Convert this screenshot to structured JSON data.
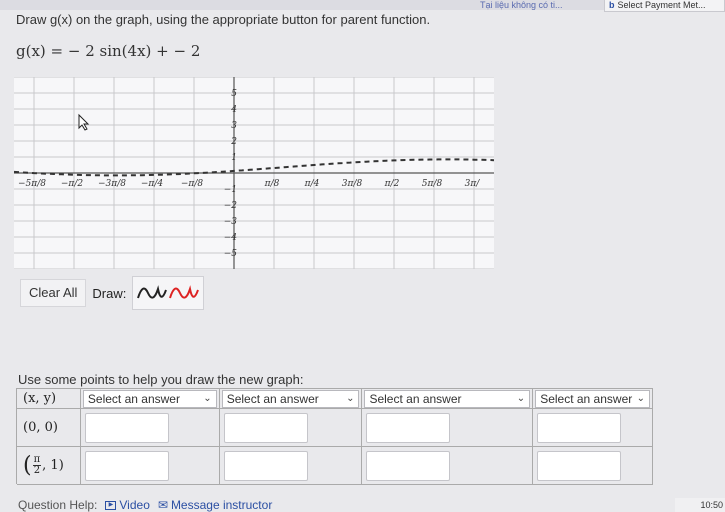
{
  "header": {
    "top_partial_text": "Tại liệu không có ti...",
    "payment_badge": "b",
    "payment_label": "Select Payment Met..."
  },
  "problem": {
    "instruction": "Draw g(x) on the graph, using the appropriate button for parent function.",
    "formula": "g(x)  =   − 2 sin(4x) +  − 2"
  },
  "graph": {
    "x_tick_labels": [
      "−5π/8",
      "−π/2",
      "−3π/8",
      "−π/4",
      "−π/8",
      "π/8",
      "π/4",
      "3π/8",
      "π/2",
      "5π/8",
      "3π/"
    ],
    "y_tick_labels": [
      "5",
      "4",
      "3",
      "2",
      "1",
      "−1",
      "−2",
      "−3",
      "−4",
      "−5"
    ],
    "x_min": -5.5,
    "x_max": 6.5,
    "y_min": -6,
    "y_max": 6
  },
  "controls": {
    "clear_all": "Clear All",
    "draw_label": "Draw:",
    "draw_button_icon": "sine-wave-icon"
  },
  "table": {
    "caption": "Use some points to help you draw the new graph:",
    "header_xy": "(x, y)",
    "dropdowns": [
      "Select an answer",
      "Select an answer",
      "Select an answer",
      "Select an answer"
    ],
    "rows": [
      {
        "point": "(0, 0)"
      },
      {
        "point_prefix": "(",
        "frac_num": "π",
        "frac_den": "2",
        "point_suffix": ", 1)"
      }
    ]
  },
  "footer": {
    "question_help": "Question Help:",
    "video": "Video",
    "message": "Message instructor",
    "clock": "10:50"
  }
}
